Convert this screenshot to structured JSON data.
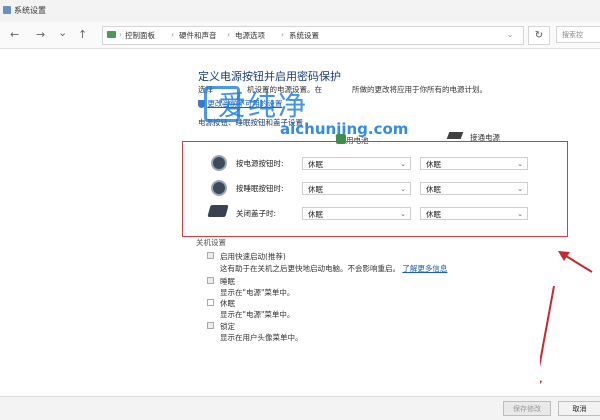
{
  "window": {
    "title": "系统设置"
  },
  "nav": {
    "back": "←",
    "forward": "→",
    "recent": "⌄",
    "up": "↑",
    "refresh": "↻"
  },
  "breadcrumb": [
    "控制面板",
    "硬件和声音",
    "电源选项",
    "系统设置"
  ],
  "search": {
    "placeholder": "搜索控"
  },
  "page": {
    "heading": "定义电源按钮并启用密码保护",
    "intro_left": "选择",
    "intro_mid": "机设置的电源设置。在",
    "intro_right": "所做的更改将应用于你所有的电源计划。",
    "unavailable_link": "更改当前不可用的设置",
    "sub_heading": "电源按钮、睡眠按钮和盖子设置"
  },
  "watermark": {
    "text": "爱纯净",
    "url": "aichunjing.com"
  },
  "columns": {
    "battery": "用电池",
    "plugged": "接通电源"
  },
  "rows": [
    {
      "label": "按电源按钮时:",
      "battery": "休眠",
      "plugged": "休眠"
    },
    {
      "label": "按睡眠按钮时:",
      "battery": "休眠",
      "plugged": "休眠"
    },
    {
      "label": "关闭盖子时:",
      "battery": "休眠",
      "plugged": "休眠"
    }
  ],
  "shutdown": {
    "title": "关机设置",
    "items": [
      {
        "label": "启用快速启动(推荐)",
        "desc": "这有助于在关机之后更快地启动电脑。不会影响重启。",
        "link": "了解更多信息"
      },
      {
        "label": "睡眠",
        "desc": "显示在\"电源\"菜单中。"
      },
      {
        "label": "休眠",
        "desc": "显示在\"电源\"菜单中。"
      },
      {
        "label": "锁定",
        "desc": "显示在用户头像菜单中。"
      }
    ]
  },
  "footer": {
    "save": "保存修改",
    "cancel": "取消"
  },
  "colors": {
    "accent": "#1b3c78",
    "highlight": "#c8424a",
    "link": "#1a5fb4"
  }
}
